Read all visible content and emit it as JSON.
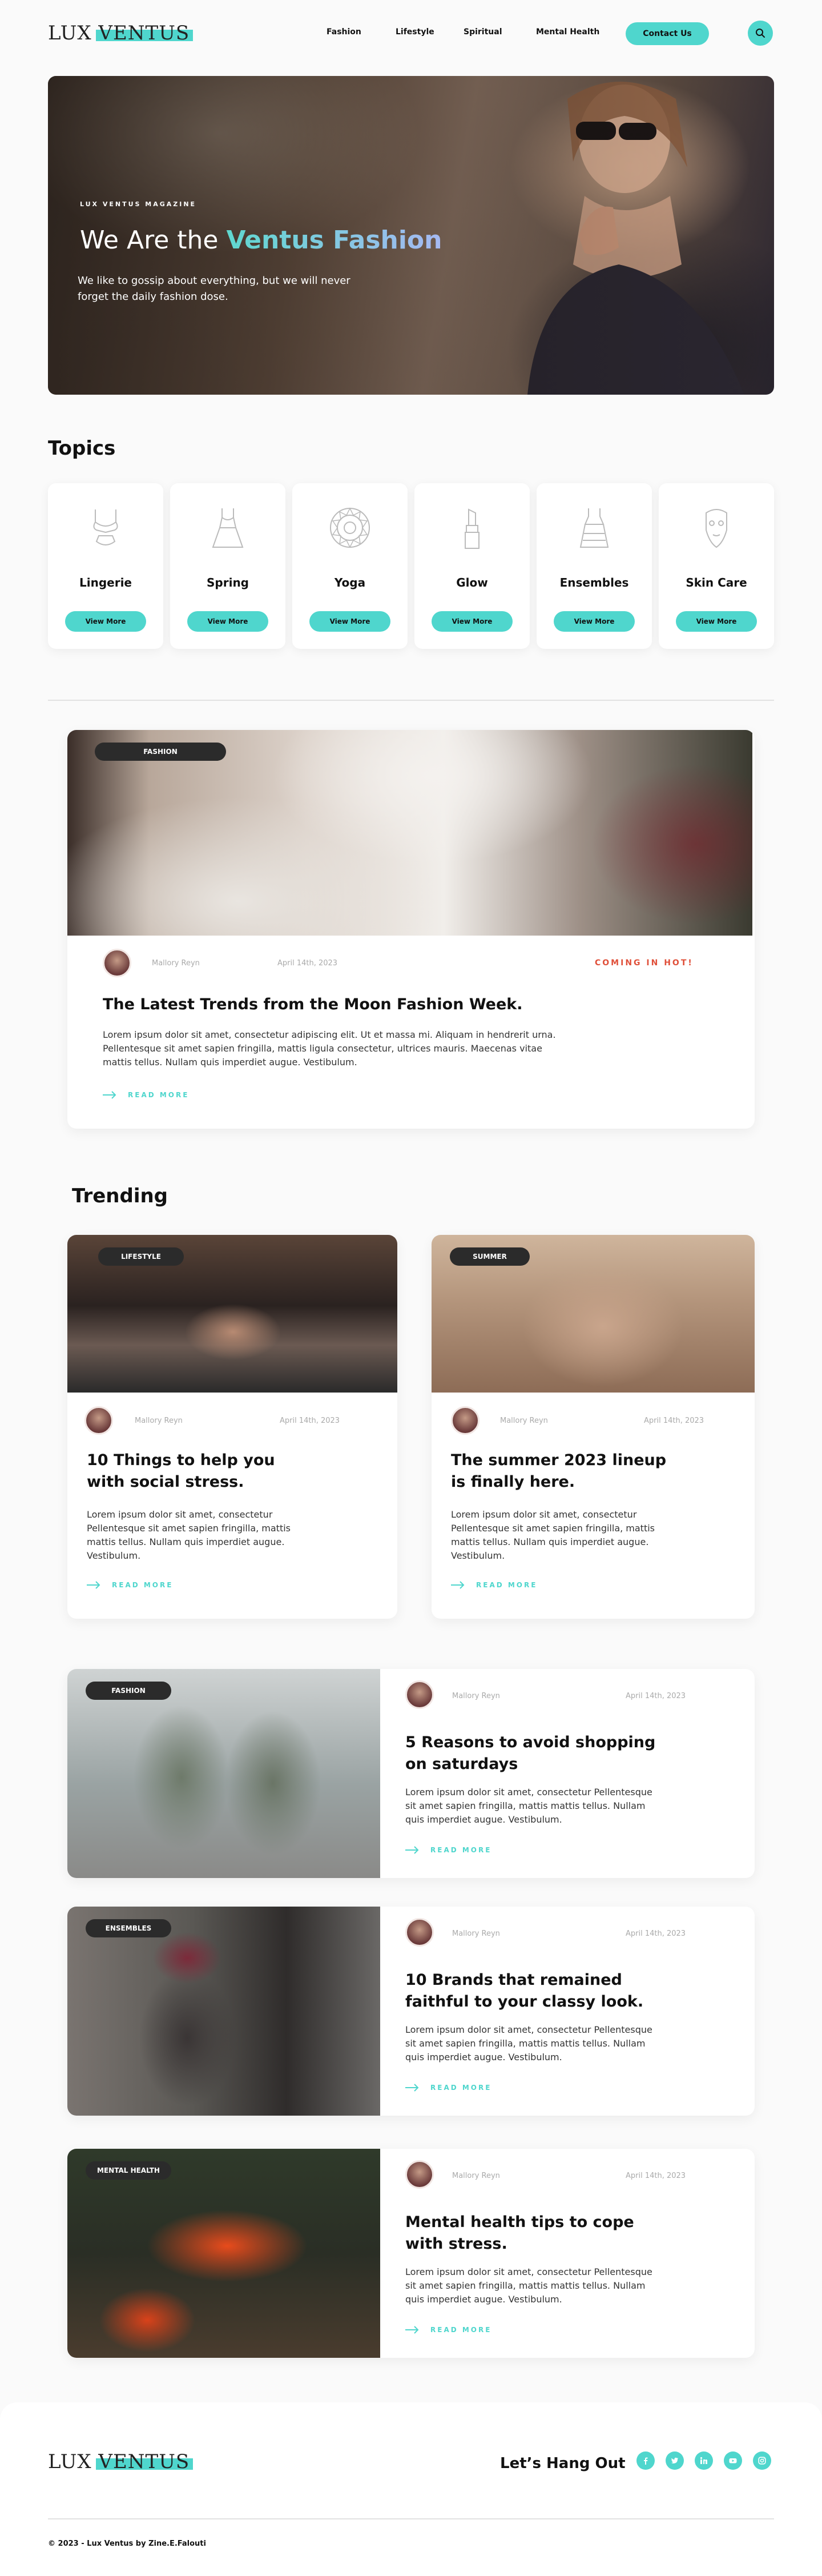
{
  "header": {
    "logo_part1": "LUX ",
    "logo_part2": "VENTUS",
    "nav": [
      "Fashion",
      "Lifestyle",
      "Spiritual",
      "Mental Health"
    ],
    "contact": "Contact Us"
  },
  "hero": {
    "kicker": "LUX VENTUS MAGAZINE",
    "title_part1": "We Are the ",
    "title_part2": "Ventus Fashion",
    "subtitle": "We like to gossip about everything, but we will never forget the daily fashion dose."
  },
  "topics": {
    "title": "Topics",
    "items": [
      {
        "name": "Lingerie",
        "button": "View More"
      },
      {
        "name": "Spring",
        "button": "View More"
      },
      {
        "name": "Yoga",
        "button": "View More"
      },
      {
        "name": "Glow",
        "button": "View More"
      },
      {
        "name": "Ensembles",
        "button": "View More"
      },
      {
        "name": "Skin Care",
        "button": "View More"
      }
    ]
  },
  "featured": {
    "tag": "FASHION",
    "author": "Mallory Reyn",
    "date": "April 14th, 2023",
    "badge": "COMING IN HOT!",
    "title": "The Latest Trends from the Moon Fashion Week.",
    "body": "Lorem ipsum dolor sit amet, consectetur adipiscing elit. Ut et massa mi. Aliquam in hendrerit urna. Pellentesque sit amet sapien fringilla, mattis ligula consectetur, ultrices mauris. Maecenas vitae mattis tellus. Nullam quis imperdiet augue. Vestibulum.",
    "read_more": "READ MORE"
  },
  "trending": {
    "title": "Trending",
    "cards": [
      {
        "tag": "LIFESTYLE",
        "author": "Mallory Reyn",
        "date": "April 14th, 2023",
        "title": "10 Things to help you with social stress.",
        "body": "Lorem ipsum dolor sit amet, consectetur Pellentesque sit amet sapien fringilla, mattis mattis tellus. Nullam quis imperdiet augue. Vestibulum.",
        "read_more": "READ MORE"
      },
      {
        "tag": "SUMMER",
        "author": "Mallory Reyn",
        "date": "April 14th, 2023",
        "title": "The summer 2023 lineup is finally here.",
        "body": "Lorem ipsum dolor sit amet, consectetur Pellentesque sit amet sapien fringilla, mattis mattis tellus. Nullam quis imperdiet augue. Vestibulum.",
        "read_more": "READ MORE"
      }
    ]
  },
  "articles": [
    {
      "tag": "FASHION",
      "author": "Mallory Reyn",
      "date": "April 14th, 2023",
      "title": "5 Reasons to avoid shopping on saturdays",
      "body": "Lorem ipsum dolor sit amet, consectetur Pellentesque sit amet sapien fringilla, mattis mattis tellus. Nullam quis imperdiet augue. Vestibulum.",
      "read_more": "READ MORE"
    },
    {
      "tag": "ENSEMBLES",
      "author": "Mallory Reyn",
      "date": "April 14th, 2023",
      "title": "10 Brands that remained faithful to your classy look.",
      "body": "Lorem ipsum dolor sit amet, consectetur Pellentesque sit amet sapien fringilla, mattis mattis tellus. Nullam quis imperdiet augue. Vestibulum.",
      "read_more": "READ MORE"
    },
    {
      "tag": "MENTAL HEALTH",
      "author": "Mallory Reyn",
      "date": "April 14th, 2023",
      "title": "Mental health tips to cope with stress.",
      "body": "Lorem ipsum dolor sit amet, consectetur Pellentesque sit amet sapien fringilla, mattis mattis tellus. Nullam quis imperdiet augue. Vestibulum.",
      "read_more": "READ MORE"
    }
  ],
  "footer": {
    "logo_part1": "LUX ",
    "logo_part2": "VENTUS",
    "hang_out": "Let’s Hang Out",
    "social_icons": [
      "facebook-icon",
      "twitter-icon",
      "linkedin-icon",
      "youtube-icon",
      "instagram-icon"
    ],
    "copyright": "© 2023 - Lux Ventus by Zine.E.Falouti"
  },
  "colors": {
    "accent": "#4fd6cd",
    "hot": "#e0503a",
    "dark": "#2b2b2b"
  }
}
